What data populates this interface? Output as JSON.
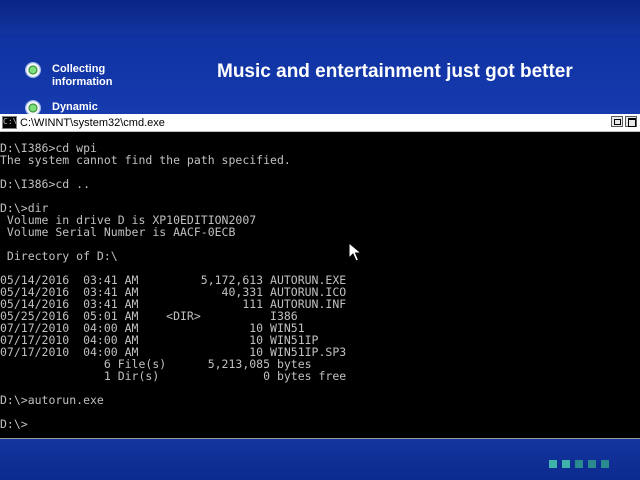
{
  "setup": {
    "steps": [
      {
        "label_line1": "Collecting",
        "label_line2": "information"
      },
      {
        "label_line1": "Dynamic",
        "label_line2": ""
      }
    ],
    "headline": "Music and entertainment just got better"
  },
  "cmd": {
    "title": "C:\\WINNT\\system32\\cmd.exe",
    "icon_text": "C:\\",
    "lines": [
      "D:\\I386>cd wpi",
      "The system cannot find the path specified.",
      "",
      "D:\\I386>cd ..",
      "",
      "D:\\>dir",
      " Volume in drive D is XP10EDITION2007",
      " Volume Serial Number is AACF-0ECB",
      "",
      " Directory of D:\\",
      "",
      "05/14/2016  03:41 AM         5,172,613 AUTORUN.EXE",
      "05/14/2016  03:41 AM            40,331 AUTORUN.ICO",
      "05/14/2016  03:41 AM               111 AUTORUN.INF",
      "05/25/2016  05:01 AM    <DIR>          I386",
      "07/17/2010  04:00 AM                10 WIN51",
      "07/17/2010  04:00 AM                10 WIN51IP",
      "07/17/2010  04:00 AM                10 WIN51IP.SP3",
      "               6 File(s)      5,213,085 bytes",
      "               1 Dir(s)               0 bytes free",
      "",
      "D:\\>autorun.exe",
      "",
      "D:\\>"
    ]
  },
  "colors": {
    "desktop_blue": "#1b45bb",
    "console_text": "#c0c0c0",
    "console_bg": "#000000"
  },
  "icons": {
    "title_icon": "cmd-icon",
    "restore": "restore-icon",
    "maximize": "maximize-icon",
    "pointer": "mouse-pointer-icon"
  }
}
